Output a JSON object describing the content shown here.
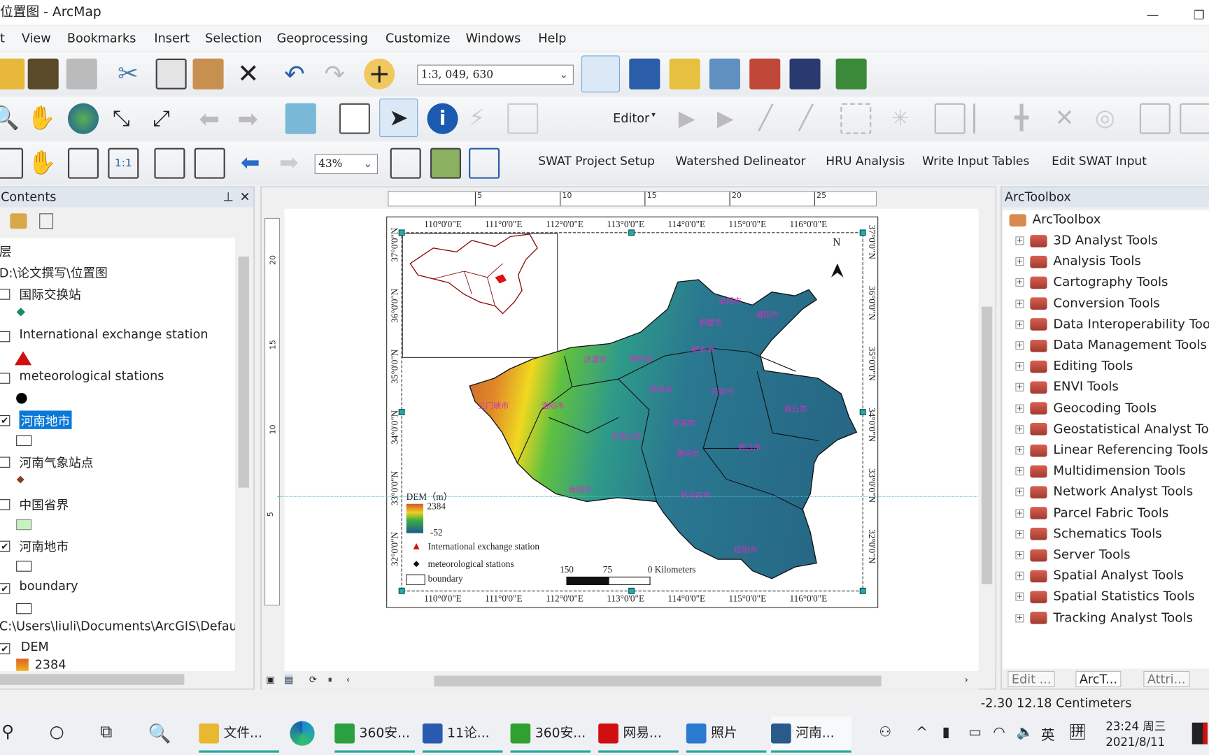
{
  "window": {
    "title": "位置图 - ArcMap",
    "minimize": "—",
    "restore": "❐"
  },
  "menu": [
    "t",
    "View",
    "Bookmarks",
    "Insert",
    "Selection",
    "Geoprocessing",
    "Customize",
    "Windows",
    "Help"
  ],
  "toolbar": {
    "scale": "1:3, 049, 630",
    "zoom": "43%",
    "editor": "Editor"
  },
  "swat_menu": [
    "SWAT Project Setup",
    "Watershed Delineator",
    "HRU Analysis",
    "Write Input Tables",
    "Edit SWAT Input"
  ],
  "toc": {
    "title": "Contents",
    "root": "层",
    "group1": "D:\\论文撰写\\位置图",
    "layers": [
      {
        "name": "国际交换站",
        "checked": false,
        "symbol": "diamond-green"
      },
      {
        "name": "International exchange station",
        "checked": false,
        "symbol": "triangle-red"
      },
      {
        "name": "meteorological stations",
        "checked": false,
        "symbol": "circle-black"
      },
      {
        "name": "河南地市",
        "checked": true,
        "symbol": "rect",
        "selected": true
      },
      {
        "name": "河南气象站点",
        "checked": false,
        "symbol": "diamond-brown"
      },
      {
        "name": "中国省界",
        "checked": false,
        "symbol": "rect-green"
      },
      {
        "name": "河南地市",
        "checked": true,
        "symbol": "rect"
      },
      {
        "name": "boundary",
        "checked": true,
        "symbol": "rect"
      }
    ],
    "group2": "C:\\Users\\liuli\\Documents\\ArcGIS\\Defau",
    "dem_name": "DEM",
    "dem_max": "2384"
  },
  "ruler": {
    "top": [
      "5",
      "10",
      "15",
      "20",
      "25"
    ],
    "left": [
      "20",
      "15",
      "10",
      "5"
    ]
  },
  "map": {
    "lon_labels": [
      "110°0'0\"E",
      "111°0'0\"E",
      "112°0'0\"E",
      "113°0'0\"E",
      "114°0'0\"E",
      "115°0'0\"E",
      "116°0'0\"E"
    ],
    "lat_labels": [
      "37°0'0\"N",
      "36°0'0\"N",
      "35°0'0\"N",
      "34°0'0\"N",
      "33°0'0\"N",
      "32°0'0\"N"
    ],
    "north": "N",
    "cities": [
      "安阳市",
      "鹤壁市",
      "濮阳市",
      "新乡市",
      "焦作市",
      "济源市",
      "郑州市",
      "开封市",
      "商丘市",
      "三门峡市",
      "洛阳市",
      "许昌市",
      "平顶山市",
      "漯河市",
      "周口市",
      "南阳市",
      "驻马店市",
      "信阳市"
    ],
    "legend": {
      "title": "DEM（m）",
      "max": "2384",
      "min": "-52",
      "items": [
        "International exchange station",
        "meteorological stations",
        "boundary"
      ]
    },
    "scalebar": [
      "150",
      "75",
      "0 Kilometers"
    ]
  },
  "toolbox": {
    "title": "ArcToolbox",
    "root": "ArcToolbox",
    "items": [
      "3D Analyst Tools",
      "Analysis Tools",
      "Cartography Tools",
      "Conversion Tools",
      "Data Interoperability Tools",
      "Data Management Tools",
      "Editing Tools",
      "ENVI Tools",
      "Geocoding Tools",
      "Geostatistical Analyst Tools",
      "Linear Referencing Tools",
      "Multidimension Tools",
      "Network Analyst Tools",
      "Parcel Fabric Tools",
      "Schematics Tools",
      "Server Tools",
      "Spatial Analyst Tools",
      "Spatial Statistics Tools",
      "Tracking Analyst Tools"
    ],
    "tabs": [
      "Edit ...",
      "ArcT...",
      "Attri..."
    ]
  },
  "status": {
    "coords": "-2.30  12.18 Centimeters"
  },
  "taskbar": {
    "apps": [
      "文件...",
      "360安...",
      "11论...",
      "360安...",
      "网易...",
      "照片",
      "河南..."
    ],
    "ime1": "英",
    "ime2": "拼",
    "time": "23:24 周三",
    "date": "2021/8/11"
  }
}
